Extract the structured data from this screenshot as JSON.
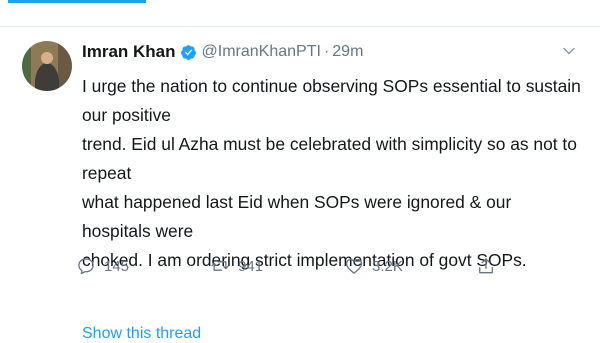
{
  "tweet": {
    "author": {
      "name": "Imran Khan",
      "handle": "@ImranKhanPTI",
      "verified": true,
      "avatar": "profile-photo"
    },
    "separator": "·",
    "time": "29m",
    "text_lines": [
      "I urge the nation to continue observing SOPs essential to sustain our positive",
      "trend. Eid ul Azha must be celebrated with simplicity so as not to repeat",
      "what happened last Eid when SOPs were ignored & our hospitals were",
      "choked. I am ordering strict implementation of govt SOPs."
    ],
    "stats": {
      "replies": "145",
      "retweets": "941",
      "likes": "3.2K"
    },
    "show_thread": "Show this thread"
  },
  "icons": {
    "more": "chevron-down-icon",
    "reply": "reply-icon",
    "retweet": "retweet-icon",
    "like": "heart-icon",
    "share": "share-icon",
    "verified": "verified-badge-icon"
  },
  "colors": {
    "accent": "#1da1f2",
    "text": "#14171a",
    "secondary": "#657786",
    "divider": "#e6ecf0"
  }
}
